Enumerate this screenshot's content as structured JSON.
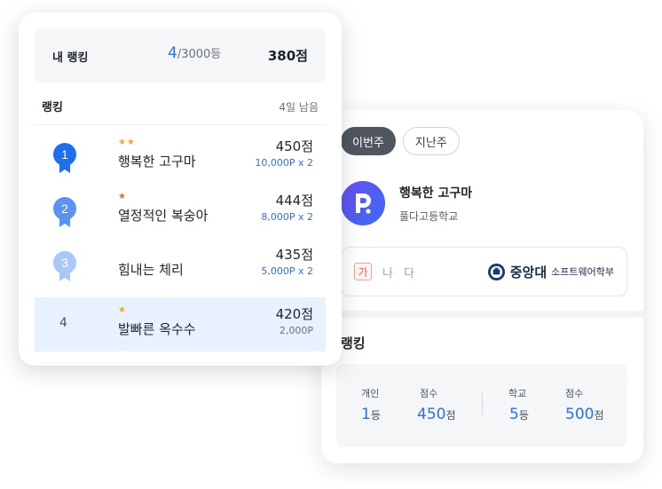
{
  "back_card": {
    "tabs": [
      {
        "label": "이번주",
        "active": true
      },
      {
        "label": "지난주",
        "active": false
      }
    ],
    "profile": {
      "name": "행복한 고구마",
      "school": "풀다고등학교"
    },
    "group_letters": [
      "가",
      "나",
      "다"
    ],
    "university": {
      "name": "중앙대",
      "department": "소프트웨어학부"
    },
    "ranking_title": "랭킹",
    "stats": {
      "individual_label": "개인",
      "individual_rank": "1",
      "individual_rank_unit": "등",
      "individual_score_label": "점수",
      "individual_score": "450",
      "individual_score_unit": "점",
      "school_label": "학교",
      "school_rank": "5",
      "school_rank_unit": "등",
      "school_score_label": "점수",
      "school_score": "500",
      "school_score_unit": "점"
    }
  },
  "front_card": {
    "my_rank": {
      "label": "내 랭킹",
      "position": "4",
      "total": "/3000등",
      "score": "380점"
    },
    "ranking_title": "랭킹",
    "remaining": "4일 남음",
    "rows": [
      {
        "rank": "1",
        "stars": "★★",
        "name": "행복한 고구마",
        "score": "450점",
        "point": "10,000P x 2"
      },
      {
        "rank": "2",
        "stars": "★",
        "name": "열정적인 복숭아",
        "score": "444점",
        "point": "8,000P x 2"
      },
      {
        "rank": "3",
        "stars": "",
        "name": "힘내는 체리",
        "score": "435점",
        "point": "5,000P x 2"
      },
      {
        "rank": "4",
        "stars": "★",
        "name": "발빠른 옥수수",
        "score": "420점",
        "point": "2,000P"
      }
    ]
  },
  "colors": {
    "accent": "#2f6fe4",
    "medal_1": "#1f6ef0",
    "medal_2": "#5b93f2",
    "medal_3": "#a9c7f7",
    "highlight": "#e8f1ff"
  },
  "icons": {
    "medal": "medal-icon",
    "emblem": "university-emblem-icon",
    "app": "app-logo-icon"
  }
}
